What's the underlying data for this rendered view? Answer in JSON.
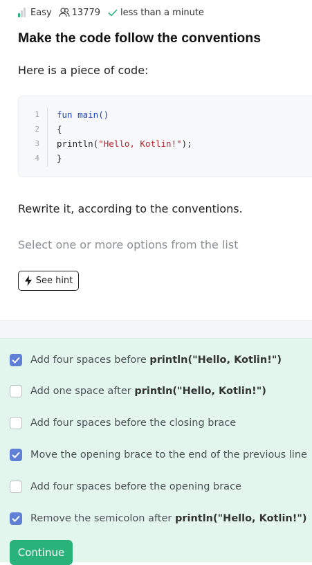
{
  "meta": {
    "difficulty": "Easy",
    "solved_count": "13779",
    "time_estimate": "less than a minute"
  },
  "title": "Make the code follow the conventions",
  "intro": "Here is a piece of code:",
  "code": {
    "lines": [
      {
        "num": "1",
        "text": "fun main()"
      },
      {
        "num": "2",
        "text": "{"
      },
      {
        "num": "3",
        "text": "println(\"Hello, Kotlin!\");"
      },
      {
        "num": "4",
        "text": "}"
      }
    ]
  },
  "instruction": "Rewrite it, according to the conventions.",
  "select_hint": "Select one or more options from the list",
  "see_hint_label": "See hint",
  "options": [
    {
      "prefix": "Add four spaces before ",
      "bold": "println(\"Hello, Kotlin!\")",
      "checked": true
    },
    {
      "prefix": "Add one space after ",
      "bold": "println(\"Hello, Kotlin!\")",
      "checked": false
    },
    {
      "prefix": "Add four spaces before the closing brace",
      "bold": "",
      "checked": false
    },
    {
      "prefix": "Move the opening brace to the end of the previous line",
      "bold": "",
      "checked": true
    },
    {
      "prefix": "Add four spaces before the opening brace",
      "bold": "",
      "checked": false
    },
    {
      "prefix": "Remove the semicolon after ",
      "bold": "println(\"Hello, Kotlin!\")",
      "checked": true
    }
  ],
  "continue_label": "Continue",
  "colors": {
    "accent_green": "#2ab27b",
    "checkbox_blue": "#5f80d6",
    "options_bg": "#e3f6ee"
  }
}
